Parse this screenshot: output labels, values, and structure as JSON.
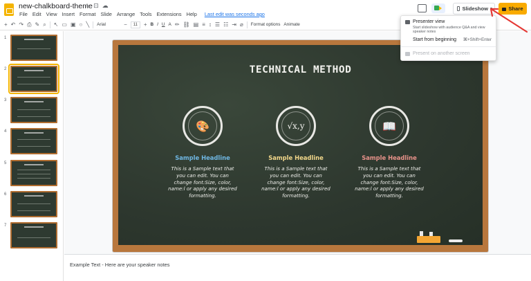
{
  "doc": {
    "title": "new-chalkboard-theme",
    "title_icons": [
      "☆",
      "⊡",
      "☁"
    ],
    "menu": [
      "File",
      "Edit",
      "View",
      "Insert",
      "Format",
      "Slide",
      "Arrange",
      "Tools",
      "Extensions",
      "Help"
    ],
    "last_edit": "Last edit was seconds ago"
  },
  "header": {
    "slideshow_label": "Slideshow",
    "share_label": "Share"
  },
  "toolbar": {
    "font": "Arial",
    "font_size": "11",
    "bold": "B",
    "italic": "I",
    "underline": "U",
    "text_color": "A",
    "format_options": "Format options",
    "animate": "Animate"
  },
  "filmstrip": {
    "slide_numbers": [
      "1",
      "2",
      "3",
      "4",
      "5",
      "6",
      "7"
    ]
  },
  "slide": {
    "title": "TECHNICAL METHOD",
    "features": [
      {
        "glyph": "🎨",
        "headline": "Sample Headline",
        "color": "#6fb7e3",
        "body": "This is a Sample text that you can edit. You can change font:Size, color, name:l or apply any desired formatting."
      },
      {
        "glyph": "√x,y",
        "headline": "Sample Headline",
        "color": "#f2d78a",
        "body": "This is a Sample text that you can edit. You can change font:Size, color, name:l or apply any desired formatting."
      },
      {
        "glyph": "📖",
        "headline": "Sample Headline",
        "color": "#e8928a",
        "body": "This is a Sample text that you can edit. You can change font:Size, color, name:l or apply any desired formatting."
      }
    ]
  },
  "notes": {
    "text": "Example Text - Here are your speaker notes"
  },
  "menu_dropdown": {
    "presenter_view": "Presenter view",
    "presenter_view_sub": "Start slideshow with audience Q&A and view speaker notes",
    "start_from_beginning": "Start from beginning",
    "start_from_beginning_kbd": "⌘+Shift+Enter",
    "present_another_screen": "Present on another screen"
  },
  "colors": {
    "share_yellow": "#f9ab00",
    "board_green": "#2f3a30",
    "frame_wood": "#b8773d",
    "annotation_red": "#e53935"
  }
}
